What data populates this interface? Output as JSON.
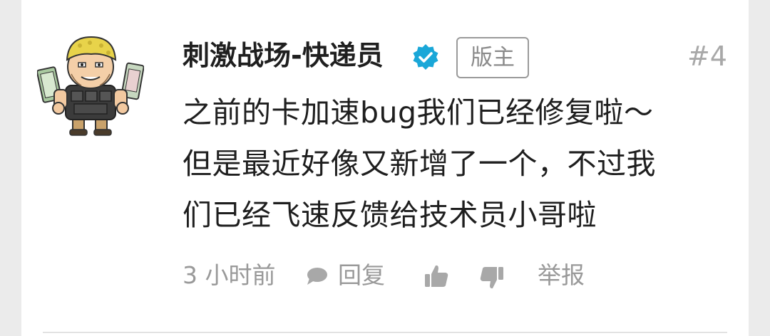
{
  "post": {
    "author": "刺激战场-快递员",
    "badge": "版主",
    "floor": "#4",
    "content_lines": [
      "之前的卡加速bug我们已经修复啦～",
      "但是最近好像又新增了一个，不过我",
      "们已经飞速反馈给技术员小哥啦"
    ],
    "time": "3 小时前",
    "reply_label": "回复",
    "report_label": "举报"
  },
  "colors": {
    "verified": "#1aa7d8",
    "meta_gray": "#999999",
    "badge_border": "#9a9a9a"
  },
  "icons": {
    "verified": "verified-check-icon",
    "reply": "speech-bubble-icon",
    "like": "thumbs-up-icon",
    "dislike": "thumbs-down-icon"
  }
}
